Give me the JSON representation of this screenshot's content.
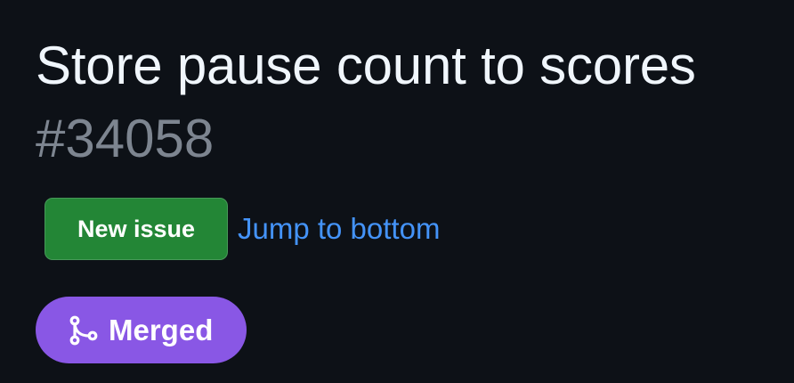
{
  "pull_request": {
    "title": "Store pause count to scores",
    "number": "#34058",
    "state": "Merged",
    "state_icon": "git-merge-icon",
    "state_color": "#8957e5"
  },
  "actions": {
    "new_issue_label": "New issue",
    "new_issue_color": "#238636",
    "jump_label": "Jump to bottom",
    "link_color": "#4493f8"
  },
  "colors": {
    "background": "#0d1117",
    "title": "#f0f6fc",
    "muted": "#7d8590"
  }
}
